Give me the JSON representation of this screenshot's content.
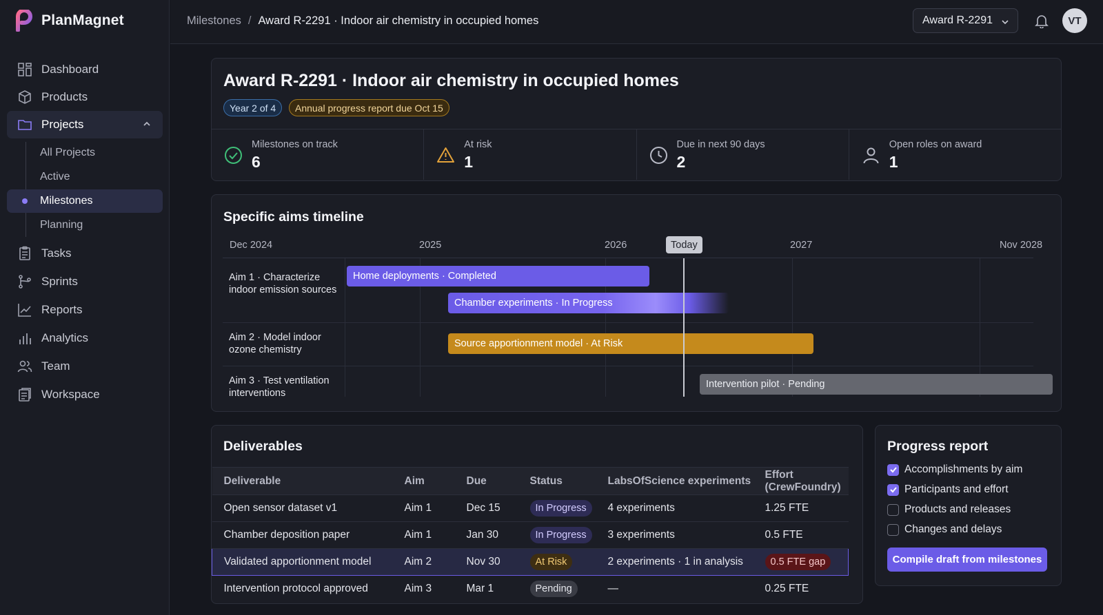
{
  "app": {
    "name": "PlanMagnet"
  },
  "sidebar": {
    "items": [
      {
        "label": "Dashboard",
        "icon": "dashboard-icon"
      },
      {
        "label": "Products",
        "icon": "box-icon"
      },
      {
        "label": "Projects",
        "icon": "folder-icon"
      },
      {
        "label": "Tasks",
        "icon": "clipboard-icon"
      },
      {
        "label": "Sprints",
        "icon": "branch-icon"
      },
      {
        "label": "Reports",
        "icon": "line-chart-icon"
      },
      {
        "label": "Analytics",
        "icon": "bar-chart-icon"
      },
      {
        "label": "Team",
        "icon": "team-icon"
      },
      {
        "label": "Workspace",
        "icon": "workspace-icon"
      }
    ],
    "subitems": [
      {
        "label": "All Projects"
      },
      {
        "label": "Active"
      },
      {
        "label": "Milestones"
      },
      {
        "label": "Planning"
      }
    ]
  },
  "header": {
    "breadcrumb": {
      "parent": "Milestones",
      "separator": "/",
      "current": "Award R-2291 · Indoor air chemistry in occupied homes"
    },
    "award_selector": "Award R-2291",
    "avatar_initials": "VT"
  },
  "award": {
    "title": "Award R-2291 · Indoor air chemistry in occupied homes",
    "year_badge": "Year 2 of 4",
    "due_badge": "Annual progress report due Oct 15"
  },
  "stats": [
    {
      "label": "Milestones on track",
      "value": "6",
      "icon": "check-circle-icon"
    },
    {
      "label": "At risk",
      "value": "1",
      "icon": "warning-icon"
    },
    {
      "label": "Due in next 90 days",
      "value": "2",
      "icon": "clock-icon"
    },
    {
      "label": "Open roles on award",
      "value": "1",
      "icon": "person-icon"
    }
  ],
  "timeline": {
    "title": "Specific aims timeline",
    "axis": [
      "Dec 2024",
      "2025",
      "2026",
      "2027",
      "Nov 2028"
    ],
    "today_label": "Today",
    "aims": [
      {
        "label": "Aim 1 · Characterize indoor emission sources"
      },
      {
        "label": "Aim 2 · Model indoor ozone chemistry"
      },
      {
        "label": "Aim 3 · Test ventilation interventions"
      }
    ],
    "bars": [
      {
        "label": "Home deployments · Completed",
        "status": "Completed"
      },
      {
        "label": "Chamber experiments · In Progress",
        "status": "In Progress"
      },
      {
        "label": "Source apportionment model · At Risk",
        "status": "At Risk"
      },
      {
        "label": "Intervention pilot · Pending",
        "status": "Pending"
      }
    ]
  },
  "deliverables": {
    "title": "Deliverables",
    "columns": [
      "Deliverable",
      "Aim",
      "Due",
      "Status",
      "LabsOfScience experiments",
      "Effort (CrewFoundry)"
    ],
    "rows": [
      {
        "deliverable": "Open sensor dataset v1",
        "aim": "Aim 1",
        "due": "Dec 15",
        "status": "In Progress",
        "experiments": "4 experiments",
        "effort": "1.25 FTE"
      },
      {
        "deliverable": "Chamber deposition paper",
        "aim": "Aim 1",
        "due": "Jan 30",
        "status": "In Progress",
        "experiments": "3 experiments",
        "effort": "0.5 FTE"
      },
      {
        "deliverable": "Validated apportionment model",
        "aim": "Aim 2",
        "due": "Nov 30",
        "status": "At Risk",
        "experiments": "2 experiments · 1 in analysis",
        "effort": "0.5 FTE gap"
      },
      {
        "deliverable": "Intervention protocol approved",
        "aim": "Aim 3",
        "due": "Mar 1",
        "status": "Pending",
        "experiments": "—",
        "effort": "0.25 FTE"
      }
    ]
  },
  "progress_report": {
    "title": "Progress report",
    "options": [
      {
        "label": "Accomplishments by aim",
        "checked": true
      },
      {
        "label": "Participants and effort",
        "checked": true
      },
      {
        "label": "Products and releases",
        "checked": false
      },
      {
        "label": "Changes and delays",
        "checked": false
      }
    ],
    "button": "Compile draft from milestones"
  },
  "colors": {
    "accent": "#6b5ce7",
    "at_risk": "#c58a1c",
    "pending": "#65676f",
    "success": "#3fbf78",
    "warning": "#e3a23a"
  }
}
